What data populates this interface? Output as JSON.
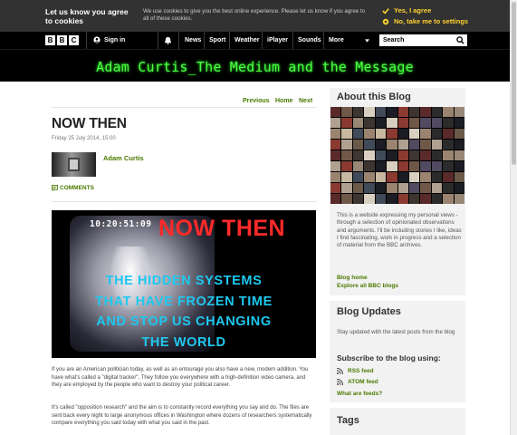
{
  "cookie_banner": {
    "title": "Let us know you agree to cookies",
    "message": "We use cookies to give you the best online experience. Please let us know if you agree to all of these cookies.",
    "agree_label": "Yes, I agree",
    "settings_label": "No, take me to settings"
  },
  "bbc_nav": {
    "logo": [
      "B",
      "B",
      "C"
    ],
    "sign_in": "Sign in",
    "items": [
      "News",
      "Sport",
      "Weather",
      "iPlayer",
      "Sounds",
      "More"
    ],
    "search_placeholder": "Search"
  },
  "blog": {
    "title": "Adam Curtis_The Medium and the Message"
  },
  "pager": {
    "previous": "Previous",
    "home": "Home",
    "next": "Next"
  },
  "post": {
    "title": "NOW THEN",
    "date": "Friday 25 July 2014, 15:00",
    "author": "Adam Curtis",
    "comments_label": "COMMENTS",
    "image": {
      "timecode": "10:20:51:09",
      "headline": "NOW THEN",
      "caption_lines": [
        "THE HIDDEN SYSTEMS",
        "THAT HAVE FROZEN TIME",
        "AND STOP US CHANGING",
        "THE WORLD"
      ]
    },
    "paragraphs": [
      "If you are an American politician today, as well as an entourage you also have a new, modern addition. You have what's called a \"digital tracker\". They follow you everywhere with a high-definition video camera, and they are employed by the people who want to destroy your political career.",
      "It's called \"opposition research\" and the aim is to constantly record everything you say and do. The files are sent back every night to large anonymous offices in Washington where dozens of researchers systematically compare everything you said today with what you said in the past."
    ]
  },
  "sidebar": {
    "about_heading": "About this Blog",
    "about_text": "This is a website expressing my personal views - through a selection of opinionated observations and arguments. I'll be including stories I like, ideas I find fascinating, work in progress and a selection of material from the BBC archives.",
    "blog_home": "Blog home",
    "explore": "Explore all BBC blogs",
    "updates_heading": "Blog Updates",
    "updates_text": "Stay updated with the latest posts from the blog",
    "subscribe_heading": "Subscribe to the blog using:",
    "rss_label": "RSS feed",
    "atom_label": "ATOM feed",
    "feeds_help": "What are feeds?",
    "tags_heading": "Tags"
  },
  "colors": {
    "link_green": "#4a7a00",
    "cookie_yellow": "#ffd230",
    "title_green": "#4cff45",
    "headline_red": "#ff2a2a",
    "caption_cyan": "#1ec8f0"
  }
}
